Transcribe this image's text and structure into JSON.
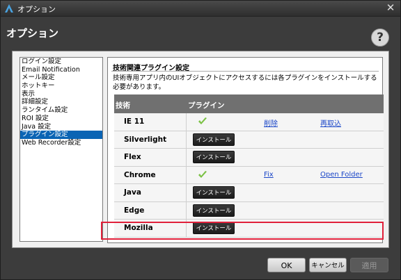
{
  "window": {
    "title": "オプション"
  },
  "header": {
    "title": "オプション",
    "help_label": "?"
  },
  "sidebar": {
    "items": [
      {
        "label": "ログイン設定"
      },
      {
        "label": "Email Notification"
      },
      {
        "label": "メール設定"
      },
      {
        "label": "ホットキー"
      },
      {
        "label": "表示"
      },
      {
        "label": "詳細設定"
      },
      {
        "label": "ランタイム設定"
      },
      {
        "label": "ROI 設定"
      },
      {
        "label": "Java 設定"
      },
      {
        "label": "プラグイン設定"
      },
      {
        "label": "Web Recorder設定"
      }
    ],
    "selected": "プラグイン設定"
  },
  "content": {
    "section_title": "技術関連プラグイン設定",
    "description": "技術専用アプリ内のUIオブジェクトにアクセスするには各プラグインをインストールする必要があります。",
    "table": {
      "headers": {
        "tech": "技術",
        "plugin": "プラグイン"
      },
      "rows": [
        {
          "name": "IE 11",
          "installed": true,
          "link1": "削除",
          "link2": "再取込"
        },
        {
          "name": "Silverlight",
          "installed": false,
          "install_label": "インストール"
        },
        {
          "name": "Flex",
          "installed": false,
          "install_label": "インストール"
        },
        {
          "name": "Chrome",
          "installed": true,
          "link1": "Fix",
          "link2": "Open Folder"
        },
        {
          "name": "Java",
          "installed": false,
          "install_label": "インストール"
        },
        {
          "name": "Edge",
          "installed": false,
          "install_label": "インストール"
        },
        {
          "name": "Mozilla",
          "installed": false,
          "install_label": "インストール",
          "highlighted": true
        }
      ]
    }
  },
  "footer": {
    "ok_label": "OK",
    "cancel_label": "キャンセル",
    "apply_label": "適用"
  },
  "colors": {
    "selected_nav": "#0a64b4",
    "link": "#1a46c8",
    "highlight": "#e0203a",
    "check": "#7ac143"
  }
}
